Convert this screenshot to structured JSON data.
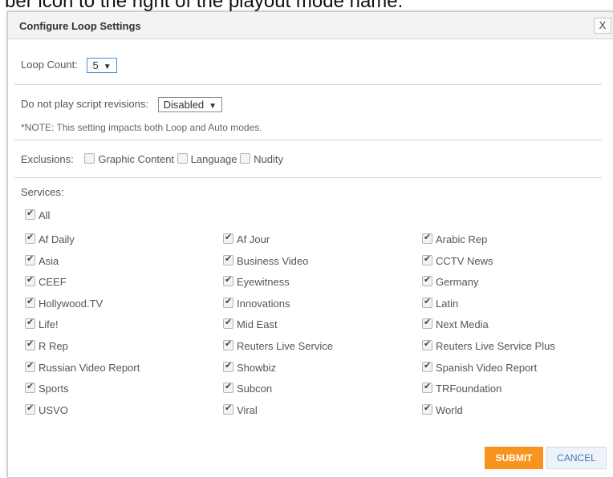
{
  "background_text": "ber icon to the right of the playout mode name.",
  "dialog": {
    "title": "Configure Loop Settings",
    "close_label": "X",
    "loop_count": {
      "label": "Loop Count:",
      "value": "5"
    },
    "script_revisions": {
      "label": "Do not play script revisions:",
      "value": "Disabled"
    },
    "note": "*NOTE: This setting impacts both Loop and Auto modes.",
    "exclusions": {
      "label": "Exclusions:",
      "options": [
        "Graphic Content",
        "Language",
        "Nudity"
      ]
    },
    "services": {
      "label": "Services:",
      "all_label": "All",
      "columns": [
        [
          "Af Daily",
          "Asia",
          "CEEF",
          "Hollywood.TV",
          "Life!",
          "R Rep",
          "Russian Video Report",
          "Sports",
          "USVO"
        ],
        [
          "Af Jour",
          "Business Video",
          "Eyewitness",
          "Innovations",
          "Mid East",
          "Reuters Live Service",
          "Showbiz",
          "Subcon",
          "Viral"
        ],
        [
          "Arabic Rep",
          "CCTV News",
          "Germany",
          "Latin",
          "Next Media",
          "Reuters Live Service Plus",
          "Spanish Video Report",
          "TRFoundation",
          "World"
        ]
      ]
    },
    "submit_label": "SUBMIT",
    "cancel_label": "CANCEL"
  },
  "colors": {
    "submit": "#f7941d",
    "cancel_text": "#3d7ab8"
  }
}
